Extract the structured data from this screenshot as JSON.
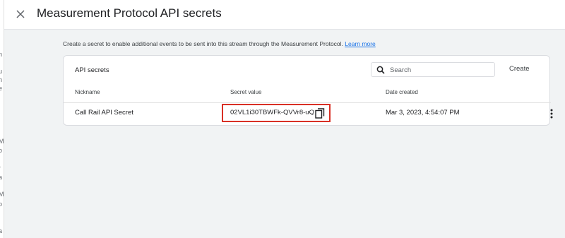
{
  "background_left": {
    "fragments": [
      "n",
      "u",
      "n",
      "e",
      "M",
      "o",
      "r",
      "a",
      "M",
      "o",
      "a"
    ]
  },
  "header": {
    "close_icon": "close-icon",
    "title": "Measurement Protocol API secrets"
  },
  "description": {
    "text": "Create a secret to enable additional events to be sent into this stream through the Measurement Protocol.",
    "link": "Learn more"
  },
  "card": {
    "title": "API secrets",
    "search": {
      "placeholder": "Search",
      "value": ""
    },
    "create_label": "Create",
    "columns": [
      "Nickname",
      "Secret value",
      "Date created"
    ],
    "rows": [
      {
        "nickname": "Call Rail API Secret",
        "secret_value": "02VL1i30TBWFk-QVVr8-uQ",
        "date_created": "Mar 3, 2023, 4:54:07 PM"
      }
    ]
  },
  "colors": {
    "accent": "#1a73e8",
    "highlight": "#d93025",
    "border": "#dadce0",
    "page_bg": "#f1f3f4"
  }
}
